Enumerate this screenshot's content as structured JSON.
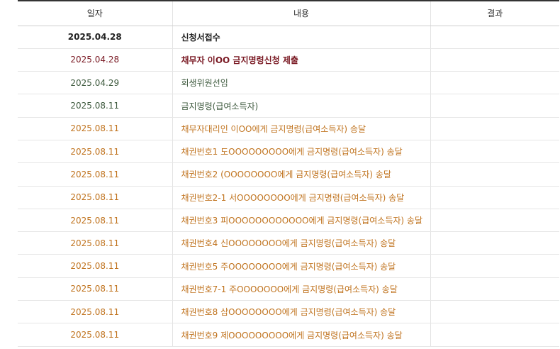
{
  "table": {
    "headers": {
      "date": "일자",
      "content": "내용",
      "result": "결과"
    },
    "rows": [
      {
        "date": "2025.04.28",
        "content": "신청서접수",
        "result": "",
        "style": "black"
      },
      {
        "date": "2025.04.28",
        "content": "채무자 이OO 금지명령신청 제출",
        "result": "",
        "style": "maroon"
      },
      {
        "date": "2025.04.29",
        "content": "회생위원선임",
        "result": "",
        "style": "green"
      },
      {
        "date": "2025.08.11",
        "content": "금지명령(급여소득자)",
        "result": "",
        "style": "green"
      },
      {
        "date": "2025.08.11",
        "content": "채무자대리인 이OO에게 금지명령(급여소득자) 송달",
        "result": "",
        "style": "orange"
      },
      {
        "date": "2025.08.11",
        "content": "채권번호1 도OOOOOOOOO에게 금지명령(급여소득자) 송달",
        "result": "",
        "style": "orange"
      },
      {
        "date": "2025.08.11",
        "content": "채권번호2 (OOOOOOOO에게 금지명령(급여소득자) 송달",
        "result": "",
        "style": "orange"
      },
      {
        "date": "2025.08.11",
        "content": "채권번호2-1 서OOOOOOOO에게 금지명령(급여소득자) 송달",
        "result": "",
        "style": "orange"
      },
      {
        "date": "2025.08.11",
        "content": "채권번호3 피OOOOOOOOOOOO에게 금지명령(급여소득자) 송달",
        "result": "",
        "style": "orange"
      },
      {
        "date": "2025.08.11",
        "content": "채권번호4 신OOOOOOOO에게 금지명령(급여소득자) 송달",
        "result": "",
        "style": "orange"
      },
      {
        "date": "2025.08.11",
        "content": "채권번호5 주OOOOOOOO에게 금지명령(급여소득자) 송달",
        "result": "",
        "style": "orange"
      },
      {
        "date": "2025.08.11",
        "content": "채권번호7-1 주OOOOOOO에게 금지명령(급여소득자) 송달",
        "result": "",
        "style": "orange"
      },
      {
        "date": "2025.08.11",
        "content": "채권번호8 삼OOOOOOOO에게 금지명령(급여소득자) 송달",
        "result": "",
        "style": "orange"
      },
      {
        "date": "2025.08.11",
        "content": "채권번호9 제OOOOOOOOO에게 금지명령(급여소득자) 송달",
        "result": "",
        "style": "orange"
      }
    ]
  },
  "colors": {
    "black": "#222222",
    "maroon": "#7a1a24",
    "green": "#3e5a3e",
    "orange": "#c0731e",
    "header_border": "#333333"
  }
}
